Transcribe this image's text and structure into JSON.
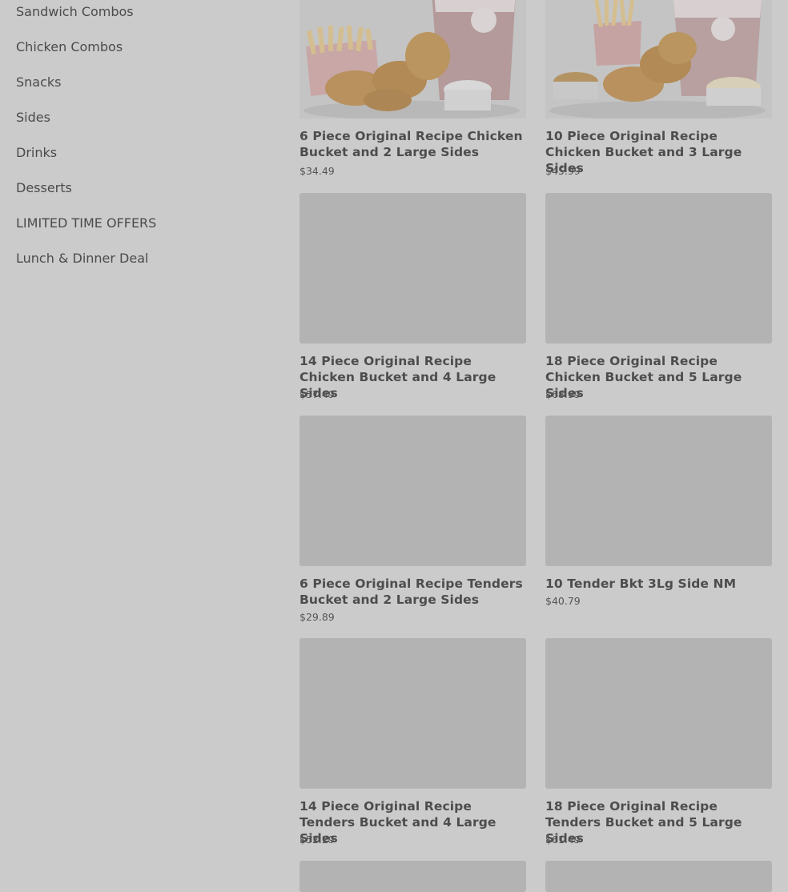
{
  "sidebar": {
    "items": [
      {
        "label": "Sandwich Combos"
      },
      {
        "label": "Chicken Combos"
      },
      {
        "label": "Snacks"
      },
      {
        "label": "Sides"
      },
      {
        "label": "Drinks"
      },
      {
        "label": "Desserts"
      },
      {
        "label": "LIMITED TIME OFFERS"
      },
      {
        "label": "Lunch & Dinner Deal"
      }
    ]
  },
  "products": [
    {
      "name": "6 Piece Original Recipe Chicken Bucket and 2 Large Sides",
      "price": "$34.49"
    },
    {
      "name": "10 Piece Original Recipe Chicken Bucket and 3 Large Sides",
      "price": "$45.99"
    },
    {
      "name": "14 Piece Original Recipe Chicken Bucket and 4 Large Sides",
      "price": "$57.49"
    },
    {
      "name": "18 Piece Original Recipe Chicken Bucket and 5 Large Sides",
      "price": "$68.99"
    },
    {
      "name": "6 Piece Original Recipe Tenders Bucket and 2 Large Sides",
      "price": "$29.89"
    },
    {
      "name": "10 Tender Bkt 3Lg Side NM",
      "price": "$40.79"
    },
    {
      "name": "14 Piece Original Recipe Tenders Bucket and 4 Large Sides",
      "price": "$52.29"
    },
    {
      "name": "18 Piece Original Recipe Tenders Bucket and 5 Large Sides",
      "price": "$61.49"
    }
  ],
  "colors": {
    "overlay_background": "#cbcbcb",
    "image_placeholder": "#b3b3b3",
    "text": "#4d4d4d"
  }
}
